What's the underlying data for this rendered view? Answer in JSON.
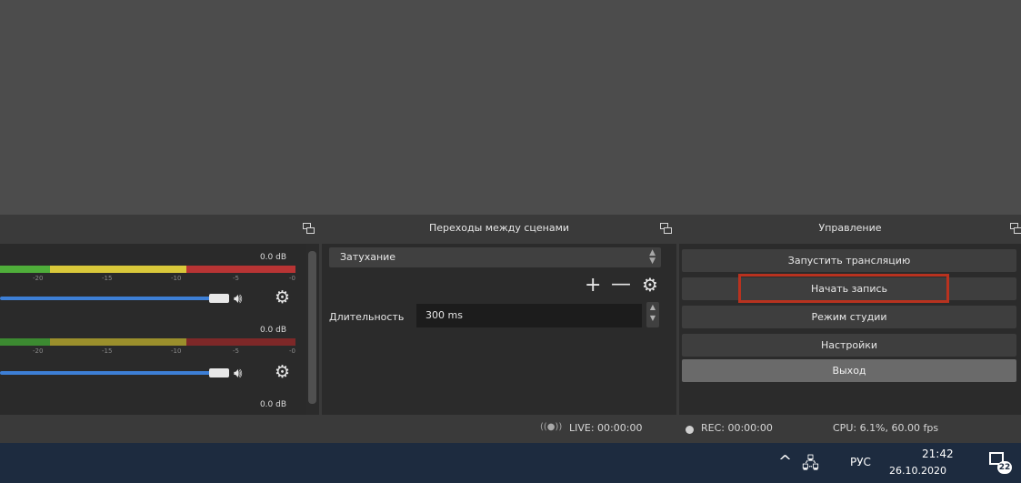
{
  "mixer": {
    "channels": [
      {
        "db_label": "0.0 dB",
        "ticks": [
          "-20",
          "-15",
          "-10",
          "-5",
          "-0"
        ]
      },
      {
        "db_label": "0.0 dB",
        "ticks": [
          "-20",
          "-15",
          "-10",
          "-5",
          "-0"
        ]
      },
      {
        "db_label": "0.0 dB"
      }
    ]
  },
  "transitions": {
    "title": "Переходы между сценами",
    "selected": "Затухание",
    "add_glyph": "+",
    "remove_glyph": "—",
    "duration_label": "Длительность",
    "duration_value": "300 ms"
  },
  "controls": {
    "title": "Управление",
    "buttons": {
      "stream": "Запустить трансляцию",
      "record": "Начать запись",
      "studio": "Режим студии",
      "settings": "Настройки",
      "exit": "Выход"
    }
  },
  "status": {
    "live": "LIVE: 00:00:00",
    "rec": "REC: 00:00:00",
    "cpu": "CPU: 6.1%, 60.00 fps"
  },
  "taskbar": {
    "lang": "РУС",
    "time": "21:42",
    "date": "26.10.2020",
    "notifications": "22"
  },
  "icons": {
    "speaker": "speaker-icon",
    "gear": "gear-icon",
    "undock": "undock-icon",
    "network": "network-icon",
    "chevron": "chevron-up-icon",
    "notifications": "notification-center-icon"
  }
}
